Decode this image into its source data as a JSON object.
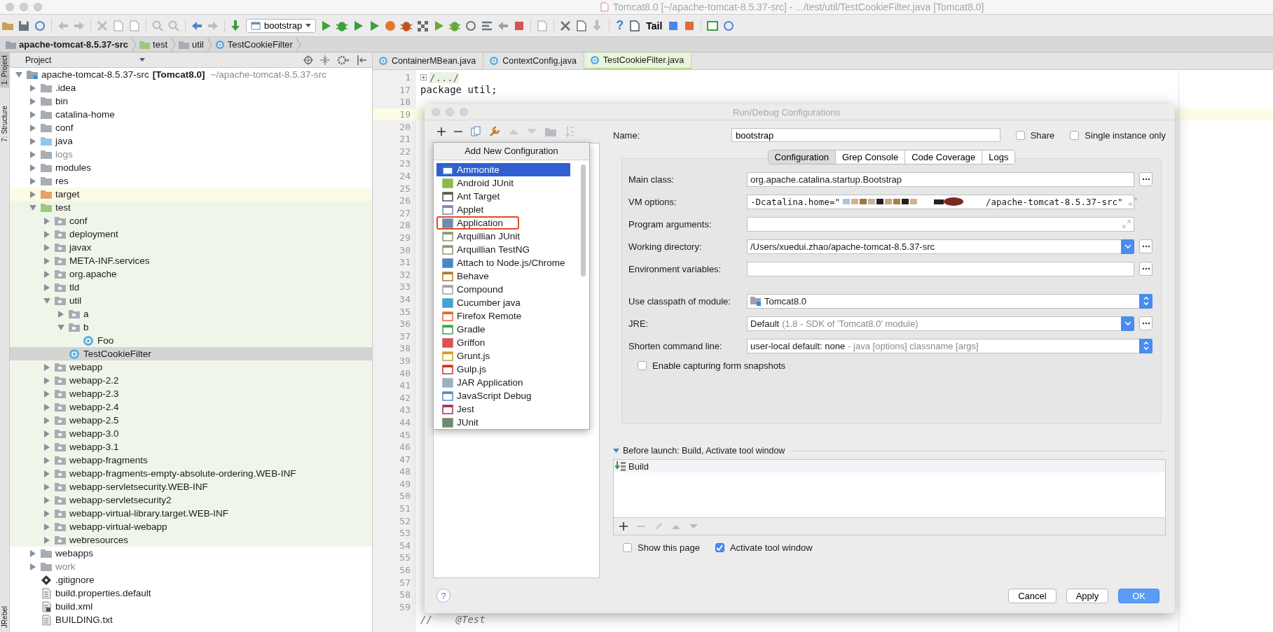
{
  "window": {
    "title": "Tomcat8.0 [~/apache-tomcat-8.5.37-src] - .../test/util/TestCookieFilter.java [Tomcat8.0]"
  },
  "toolbar": {
    "run_configuration": "bootstrap",
    "help_glyph": "?",
    "tail_label": "Tail"
  },
  "breadcrumb": [
    {
      "label": "apache-tomcat-8.5.37-src",
      "kind": "module"
    },
    {
      "label": "test",
      "kind": "test-folder"
    },
    {
      "label": "util",
      "kind": "package"
    },
    {
      "label": "TestCookieFilter",
      "kind": "class"
    }
  ],
  "side_tabs": [
    {
      "label": "1: Project",
      "selected": true
    },
    {
      "label": "7: Structure",
      "selected": false
    },
    {
      "label": "JRebel",
      "selected": false
    }
  ],
  "project_panel": {
    "title": "Project",
    "tree": [
      {
        "label": "apache-tomcat-8.5.37-src",
        "module": "[Tomcat8.0]",
        "path": "~/apache-tomcat-8.5.37-src",
        "kind": "module",
        "expanded": true,
        "selected": false,
        "children": [
          {
            "label": ".idea",
            "kind": "folder",
            "expanded": false,
            "selected": false
          },
          {
            "label": "bin",
            "kind": "folder",
            "expanded": false,
            "selected": false
          },
          {
            "label": "catalina-home",
            "kind": "folder",
            "expanded": false,
            "selected": false
          },
          {
            "label": "conf",
            "kind": "folder",
            "expanded": false,
            "selected": false
          },
          {
            "label": "java",
            "kind": "source-folder",
            "expanded": false,
            "selected": false
          },
          {
            "label": "logs",
            "kind": "excluded-folder",
            "expanded": false,
            "selected": false
          },
          {
            "label": "modules",
            "kind": "folder",
            "expanded": false,
            "selected": false
          },
          {
            "label": "res",
            "kind": "folder",
            "expanded": false,
            "selected": false
          },
          {
            "label": "target",
            "kind": "output-folder",
            "expanded": false,
            "selected": false
          },
          {
            "label": "test",
            "kind": "test-folder",
            "expanded": true,
            "selected": false,
            "children": [
              {
                "label": "conf",
                "kind": "package",
                "expanded": false,
                "selected": false
              },
              {
                "label": "deployment",
                "kind": "package",
                "expanded": false,
                "selected": false
              },
              {
                "label": "javax",
                "kind": "package",
                "expanded": false,
                "selected": false
              },
              {
                "label": "META-INF.services",
                "kind": "package",
                "expanded": false,
                "selected": false
              },
              {
                "label": "org.apache",
                "kind": "package",
                "expanded": false,
                "selected": false
              },
              {
                "label": "tld",
                "kind": "package",
                "expanded": false,
                "selected": false
              },
              {
                "label": "util",
                "kind": "package",
                "expanded": true,
                "selected": false,
                "children": [
                  {
                    "label": "a",
                    "kind": "package",
                    "expanded": false,
                    "selected": false
                  },
                  {
                    "label": "b",
                    "kind": "package",
                    "expanded": true,
                    "selected": false,
                    "children": [
                      {
                        "label": "Foo",
                        "kind": "class",
                        "selected": false
                      }
                    ]
                  },
                  {
                    "label": "TestCookieFilter",
                    "kind": "class",
                    "selected": true
                  }
                ]
              },
              {
                "label": "webapp",
                "kind": "package",
                "expanded": false,
                "selected": false
              },
              {
                "label": "webapp-2.2",
                "kind": "package",
                "expanded": false,
                "selected": false
              },
              {
                "label": "webapp-2.3",
                "kind": "package",
                "expanded": false,
                "selected": false
              },
              {
                "label": "webapp-2.4",
                "kind": "package",
                "expanded": false,
                "selected": false
              },
              {
                "label": "webapp-2.5",
                "kind": "package",
                "expanded": false,
                "selected": false
              },
              {
                "label": "webapp-3.0",
                "kind": "package",
                "expanded": false,
                "selected": false
              },
              {
                "label": "webapp-3.1",
                "kind": "package",
                "expanded": false,
                "selected": false
              },
              {
                "label": "webapp-fragments",
                "kind": "package",
                "expanded": false,
                "selected": false
              },
              {
                "label": "webapp-fragments-empty-absolute-ordering.WEB-INF",
                "kind": "package",
                "expanded": false,
                "selected": false
              },
              {
                "label": "webapp-servletsecurity.WEB-INF",
                "kind": "package",
                "expanded": false,
                "selected": false
              },
              {
                "label": "webapp-servletsecurity2",
                "kind": "package",
                "expanded": false,
                "selected": false
              },
              {
                "label": "webapp-virtual-library.target.WEB-INF",
                "kind": "package",
                "expanded": false,
                "selected": false
              },
              {
                "label": "webapp-virtual-webapp",
                "kind": "package",
                "expanded": false,
                "selected": false
              },
              {
                "label": "webresources",
                "kind": "package",
                "expanded": false,
                "selected": false
              }
            ]
          },
          {
            "label": "webapps",
            "kind": "folder",
            "expanded": false,
            "selected": false
          },
          {
            "label": "work",
            "kind": "excluded-folder",
            "expanded": false,
            "selected": false
          },
          {
            "label": ".gitignore",
            "kind": "git-file",
            "selected": false
          },
          {
            "label": "build.properties.default",
            "kind": "text-file",
            "selected": false
          },
          {
            "label": "build.xml",
            "kind": "xml-file",
            "selected": false
          },
          {
            "label": "BUILDING.txt",
            "kind": "text-file",
            "selected": false
          }
        ]
      }
    ]
  },
  "editor": {
    "tabs": [
      {
        "label": "ContainerMBean.java",
        "selected": false
      },
      {
        "label": "ContextConfig.java",
        "selected": false
      },
      {
        "label": "TestCookieFilter.java",
        "selected": true
      }
    ],
    "lines": [
      {
        "n": "1",
        "code": "/.../",
        "kind": "fold",
        "current": false
      },
      {
        "n": "17",
        "code": "package util;",
        "kind": "package",
        "current": false
      },
      {
        "n": "18",
        "current": false
      },
      {
        "n": "19",
        "current": true
      },
      {
        "n": "20",
        "current": false
      },
      {
        "n": "21",
        "current": false
      },
      {
        "n": "22",
        "current": false
      },
      {
        "n": "23",
        "current": false
      },
      {
        "n": "24",
        "current": false
      },
      {
        "n": "25",
        "current": false
      },
      {
        "n": "26",
        "current": false
      },
      {
        "n": "27",
        "current": false
      },
      {
        "n": "28",
        "current": false
      },
      {
        "n": "29",
        "current": false
      },
      {
        "n": "30",
        "current": false
      },
      {
        "n": "31",
        "current": false
      },
      {
        "n": "32",
        "current": false
      },
      {
        "n": "33",
        "current": false
      },
      {
        "n": "34",
        "current": false
      },
      {
        "n": "35",
        "current": false
      },
      {
        "n": "36",
        "current": false
      },
      {
        "n": "37",
        "current": false
      },
      {
        "n": "38",
        "current": false
      },
      {
        "n": "39",
        "current": false
      },
      {
        "n": "40",
        "current": false
      },
      {
        "n": "41",
        "current": false
      },
      {
        "n": "42",
        "current": false
      },
      {
        "n": "43",
        "current": false
      },
      {
        "n": "44",
        "current": false
      },
      {
        "n": "45",
        "current": false
      },
      {
        "n": "46",
        "current": false
      },
      {
        "n": "47",
        "current": false
      },
      {
        "n": "48",
        "current": false
      },
      {
        "n": "49",
        "current": false
      },
      {
        "n": "50",
        "current": false
      },
      {
        "n": "51",
        "current": false
      },
      {
        "n": "52",
        "current": false
      },
      {
        "n": "53",
        "current": false
      },
      {
        "n": "54",
        "current": false
      },
      {
        "n": "55",
        "current": false
      },
      {
        "n": "56",
        "current": false
      },
      {
        "n": "57",
        "current": false
      },
      {
        "n": "58",
        "current": false
      },
      {
        "n": "59",
        "current": false
      },
      {
        "code": "//    @Test",
        "kind": "comment",
        "current": false
      }
    ]
  },
  "dialog": {
    "title": "Run/Debug Configurations",
    "help_label": "?",
    "add_menu": {
      "title": "Add New Configuration",
      "items": [
        {
          "label": "Ammonite",
          "selected": true,
          "outlined": false
        },
        {
          "label": "Android JUnit",
          "selected": false,
          "outlined": false
        },
        {
          "label": "Ant Target",
          "selected": false,
          "outlined": false
        },
        {
          "label": "Applet",
          "selected": false,
          "outlined": false
        },
        {
          "label": "Application",
          "selected": false,
          "outlined": true
        },
        {
          "label": "Arquillian JUnit",
          "selected": false,
          "outlined": false
        },
        {
          "label": "Arquillian TestNG",
          "selected": false,
          "outlined": false
        },
        {
          "label": "Attach to Node.js/Chrome",
          "selected": false,
          "outlined": false
        },
        {
          "label": "Behave",
          "selected": false,
          "outlined": false
        },
        {
          "label": "Compound",
          "selected": false,
          "outlined": false
        },
        {
          "label": "Cucumber java",
          "selected": false,
          "outlined": false
        },
        {
          "label": "Firefox Remote",
          "selected": false,
          "outlined": false
        },
        {
          "label": "Gradle",
          "selected": false,
          "outlined": false
        },
        {
          "label": "Griffon",
          "selected": false,
          "outlined": false
        },
        {
          "label": "Grunt.js",
          "selected": false,
          "outlined": false
        },
        {
          "label": "Gulp.js",
          "selected": false,
          "outlined": false
        },
        {
          "label": "JAR Application",
          "selected": false,
          "outlined": false
        },
        {
          "label": "JavaScript Debug",
          "selected": false,
          "outlined": false
        },
        {
          "label": "Jest",
          "selected": false,
          "outlined": false
        },
        {
          "label": "JUnit",
          "selected": false,
          "outlined": false
        }
      ]
    },
    "name_label": "Name:",
    "name_value": "bootstrap",
    "options": [
      {
        "label": "Share",
        "checked": false
      },
      {
        "label": "Single instance only",
        "checked": false
      }
    ],
    "tabs": [
      {
        "label": "Configuration",
        "selected": true
      },
      {
        "label": "Grep Console",
        "selected": false
      },
      {
        "label": "Code Coverage",
        "selected": false
      },
      {
        "label": "Logs",
        "selected": false
      }
    ],
    "fields": [
      {
        "label": "Main class:",
        "kind": "text",
        "value": "org.apache.catalina.startup.Bootstrap",
        "browse": true
      },
      {
        "label": "VM options:",
        "kind": "expand",
        "value": "-Dcatalina.home=\"",
        "redacted": true,
        "value_end": "/apache-tomcat-8.5.37-src\"",
        "browse": false
      },
      {
        "label": "Program arguments:",
        "kind": "expand",
        "browse": false
      },
      {
        "label": "Working directory:",
        "kind": "combo",
        "value": "/Users/xuedui.zhao/apache-tomcat-8.5.37-src",
        "browse": true
      },
      {
        "label": "Environment variables:",
        "kind": "text",
        "browse": true
      }
    ],
    "module_fields": [
      {
        "label": "Use classpath of module:",
        "kind": "select",
        "value": "Tomcat8.0",
        "module_icon": true,
        "browse": false
      },
      {
        "label": "JRE:",
        "kind": "combo",
        "value": "Default",
        "hint": "(1.8 - SDK of 'Tomcat8.0' module)",
        "browse": true
      },
      {
        "label": "Shorten command line:",
        "kind": "select",
        "value": "user-local default: none",
        "hint": "- java [options] classname [args]",
        "browse": false
      }
    ],
    "snapshot_option": {
      "label": "Enable capturing form snapshots",
      "checked": false
    },
    "before_launch": {
      "title": "Before launch: Build, Activate tool window",
      "expanded": true,
      "tasks": [
        "Build"
      ]
    },
    "launch_options": [
      {
        "label": "Show this page",
        "checked": false
      },
      {
        "label": "Activate tool window",
        "checked": true
      }
    ],
    "buttons": [
      {
        "label": "Cancel",
        "kind": "normal"
      },
      {
        "label": "Apply",
        "kind": "normal"
      },
      {
        "label": "OK",
        "kind": "default"
      }
    ]
  }
}
